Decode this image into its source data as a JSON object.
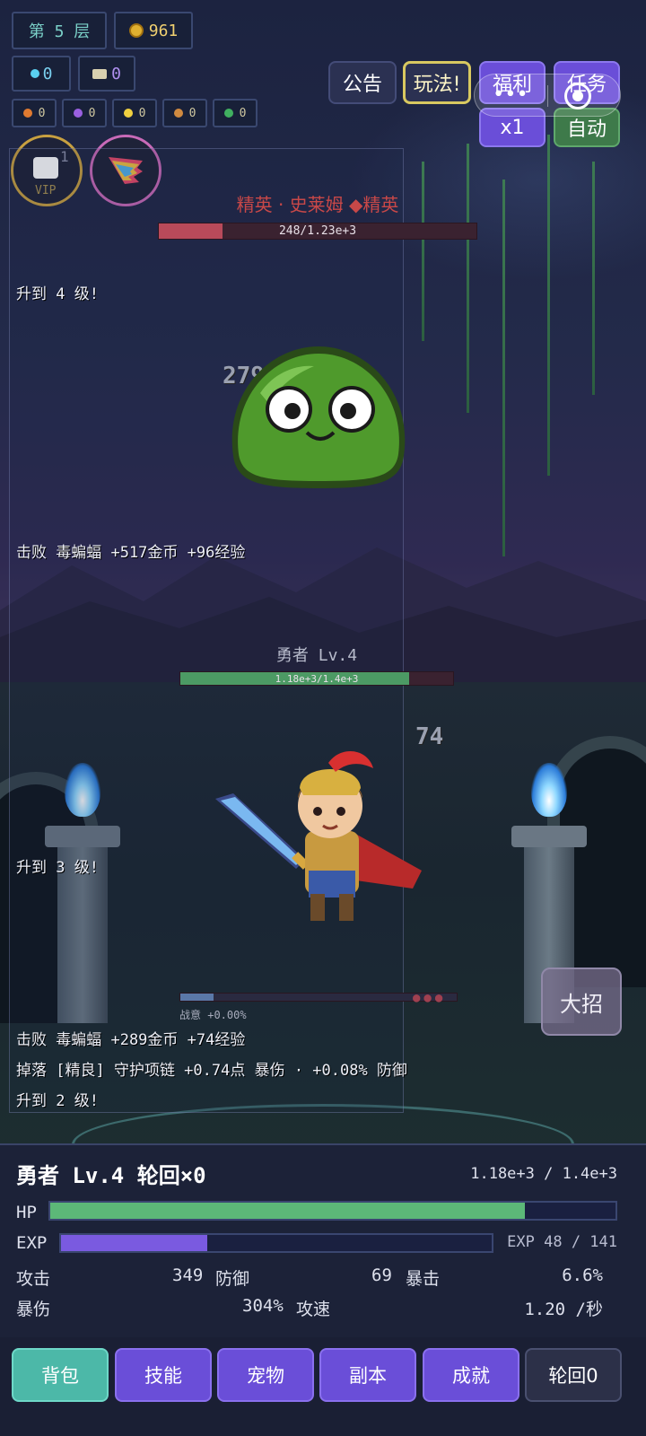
{
  "hud": {
    "floor": "第 5 层",
    "gold": "961",
    "diamonds": "0",
    "tickets": "0",
    "materials": [
      {
        "icon": "orange-gem-icon",
        "color": "#e07a30",
        "value": "0"
      },
      {
        "icon": "purple-drop-icon",
        "color": "#9a60e0",
        "value": "0"
      },
      {
        "icon": "star-icon",
        "color": "#f0d040",
        "value": "0"
      },
      {
        "icon": "medal-icon",
        "color": "#d08a40",
        "value": "0"
      },
      {
        "icon": "green-orb-icon",
        "color": "#40b060",
        "value": "0"
      }
    ]
  },
  "buttons": {
    "notice": "公告",
    "gameplay": "玩法!",
    "welfare": "福利",
    "tasks": "任务",
    "speed": "x1",
    "auto": "自动",
    "ultimate": "大招"
  },
  "vip": {
    "label": "VIP",
    "level": "1"
  },
  "enemy": {
    "name": "精英 · 史莱姆 ◆精英",
    "hp_text": "248/1.23e+3",
    "hp_fraction": 0.2
  },
  "damage": {
    "enemy_hit": "279",
    "hero_hit": "74"
  },
  "hero_overhead": {
    "name": "勇者 Lv.4",
    "hp_text": "1.18e+3/1.4e+3",
    "hp_fraction": 0.84
  },
  "charge": {
    "label": "战意 +0.00%",
    "fraction": 0.12
  },
  "log": [
    "升到 4 级!",
    "击败 毒蝙蝠  +517金币 +96经验",
    "升到 3 级!",
    "击败 毒蝙蝠  +289金币 +74经验",
    "掉落 [精良] 守护项链 +0.74点 暴伤 · +0.08% 防御",
    "升到 2 级!"
  ],
  "stats": {
    "title": "勇者 Lv.4  轮回×0",
    "hp_value": "1.18e+3 / 1.4e+3",
    "hp_label": "HP",
    "hp_fraction": 0.84,
    "exp_label": "EXP",
    "exp_value": "EXP 48 / 141",
    "exp_fraction": 0.34,
    "atk_label": "攻击",
    "atk": "349",
    "def_label": "防御",
    "def": "69",
    "crit_label": "暴击",
    "crit": "6.6%",
    "critdmg_label": "暴伤",
    "critdmg": "304%",
    "spd_label": "攻速",
    "spd": "1.20 /秒"
  },
  "nav": [
    "背包",
    "技能",
    "宠物",
    "副本",
    "成就",
    "轮回0"
  ],
  "colors": {
    "accent_purple": "#6a4ed8",
    "active_teal": "#4cb8a8",
    "hp_green": "#5cb878",
    "exp_purple": "#7a5ae0",
    "enemy_red": "#c84848"
  }
}
